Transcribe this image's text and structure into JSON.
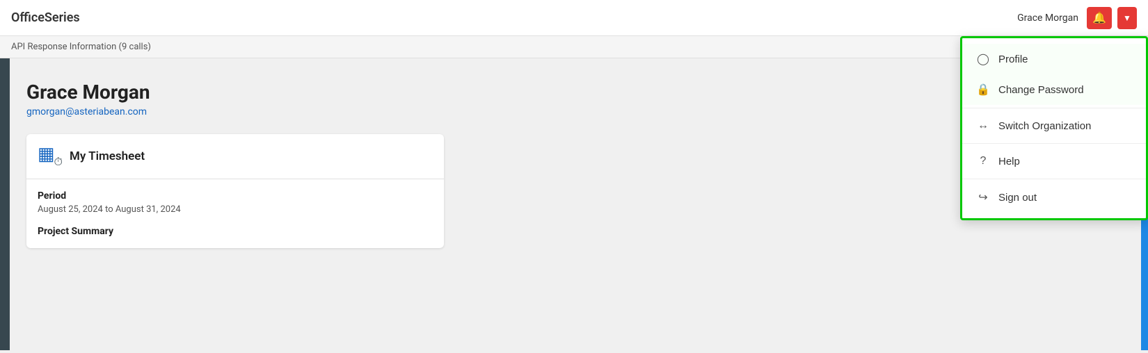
{
  "app": {
    "name": "OfficeSeries"
  },
  "header": {
    "username": "Grace Morgan",
    "notification_label": "notifications",
    "dropdown_label": "menu"
  },
  "api_bar": {
    "text": "API Response Information (9 calls)"
  },
  "user": {
    "name": "Grace Morgan",
    "email": "gmorgan@asteriabean.com"
  },
  "timesheet": {
    "title": "My Timesheet",
    "period_label": "Period",
    "period_value": "August 25, 2024 to August 31, 2024",
    "project_summary_label": "Project Summary"
  },
  "dropdown": {
    "items": [
      {
        "id": "profile",
        "label": "Profile",
        "icon": "person"
      },
      {
        "id": "change-password",
        "label": "Change Password",
        "icon": "lock"
      },
      {
        "id": "switch-org",
        "label": "Switch Organization",
        "icon": "arrows"
      },
      {
        "id": "help",
        "label": "Help",
        "icon": "question"
      },
      {
        "id": "sign-out",
        "label": "Sign out",
        "icon": "exit"
      }
    ]
  },
  "colors": {
    "accent_red": "#e53935",
    "accent_blue": "#1e88e5",
    "sidebar_dark": "#37474f",
    "highlight_green": "#00c800"
  }
}
